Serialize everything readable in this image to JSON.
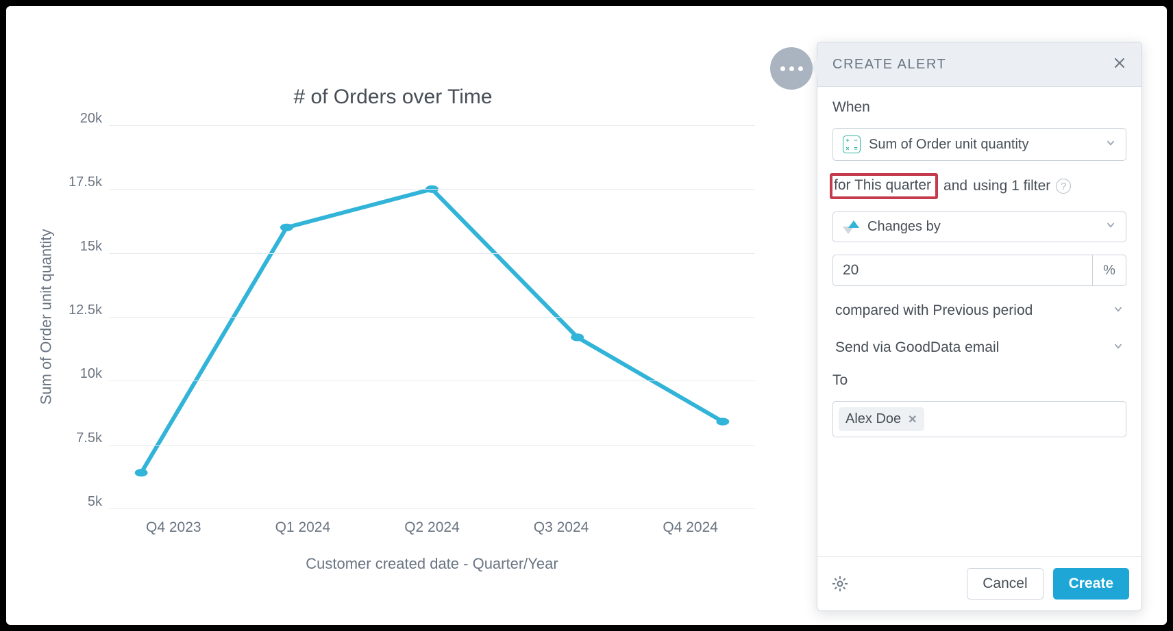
{
  "chart_data": {
    "type": "line",
    "title": "# of Orders over Time",
    "xlabel": "Customer created date - Quarter/Year",
    "ylabel": "Sum of Order unit quantity",
    "categories": [
      "Q4 2023",
      "Q1 2024",
      "Q2 2024",
      "Q3 2024",
      "Q4 2024"
    ],
    "values": [
      6400,
      16000,
      17500,
      11700,
      8400
    ],
    "y_ticks": [
      "20k",
      "17.5k",
      "15k",
      "12.5k",
      "10k",
      "7.5k",
      "5k"
    ],
    "ylim": [
      5000,
      20000
    ]
  },
  "alert_panel": {
    "header": "CREATE ALERT",
    "when_label": "When",
    "metric_name": "Sum of Order unit quantity",
    "for_prefix": "for",
    "for_period": "This quarter",
    "and_text": "and",
    "using_filter_text": "using 1 filter",
    "condition_label": "Changes by",
    "value": "20",
    "unit": "%",
    "compared_with": "compared with Previous period",
    "send_via": "Send via GoodData email",
    "to_label": "To",
    "recipient": "Alex Doe",
    "cancel": "Cancel",
    "create": "Create"
  }
}
